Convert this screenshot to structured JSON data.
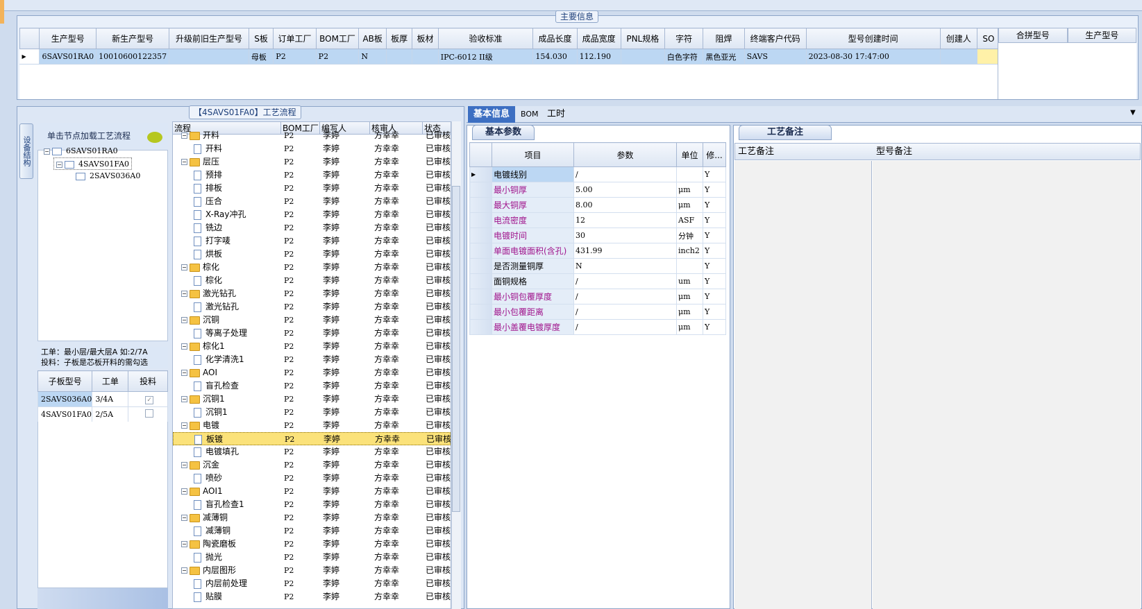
{
  "main_info": {
    "title": "主要信息",
    "columns": [
      "生产型号",
      "新生产型号",
      "升级前旧生产型号",
      "S板",
      "订单工厂",
      "BOM工厂",
      "AB板",
      "板厚",
      "板材",
      "验收标准",
      "成品长度",
      "成品宽度",
      "PNL规格",
      "字符",
      "阻焊",
      "终端客户代码",
      "型号创建时间",
      "创建人",
      "SO"
    ],
    "row": [
      "6SAVS01RA0",
      "10010600122357",
      "",
      "母板",
      "P2",
      "P2",
      "N",
      "",
      "",
      "IPC-6012 II级",
      "154.030",
      "112.190",
      "",
      "白色字符",
      "黑色亚光",
      "SAVS",
      "2023-08-30 17:47:00",
      "",
      ""
    ],
    "merge_columns": [
      "合拼型号",
      "生产型号"
    ]
  },
  "process": {
    "title": "【4SAVS01FA0】工艺流程",
    "side_tab": "设备结构",
    "hint": "单击节点加载工艺流程",
    "tree": [
      "6SAVS01RA0",
      "4SAVS01FA0",
      "2SAVS036A0"
    ],
    "note_line1": "工单：最小层/最大层A 如:2/7A",
    "note_line2": "投料：子板是芯板开料的需勾选",
    "sub_columns": [
      "子板型号",
      "工单",
      "投料"
    ],
    "sub_rows": [
      [
        "2SAVS036A0",
        "3/4A",
        "true"
      ],
      [
        "4SAVS01FA0",
        "2/5A",
        "false"
      ]
    ],
    "grid_columns": [
      "流程",
      "BOM工厂",
      "编写人",
      "核审人",
      "状态"
    ],
    "grid_rows": [
      {
        "name": "开料",
        "level": 0,
        "factory": "P2",
        "writer": "李婷",
        "reviewer": "方幸幸",
        "status": "已审核"
      },
      {
        "name": "开料",
        "level": 1,
        "factory": "P2",
        "writer": "李婷",
        "reviewer": "方幸幸",
        "status": "已审核"
      },
      {
        "name": "层压",
        "level": 0,
        "factory": "P2",
        "writer": "李婷",
        "reviewer": "方幸幸",
        "status": "已审核"
      },
      {
        "name": "预排",
        "level": 1,
        "factory": "P2",
        "writer": "李婷",
        "reviewer": "方幸幸",
        "status": "已审核"
      },
      {
        "name": "排板",
        "level": 1,
        "factory": "P2",
        "writer": "李婷",
        "reviewer": "方幸幸",
        "status": "已审核"
      },
      {
        "name": "压合",
        "level": 1,
        "factory": "P2",
        "writer": "李婷",
        "reviewer": "方幸幸",
        "status": "已审核"
      },
      {
        "name": "X-Ray冲孔",
        "level": 1,
        "factory": "P2",
        "writer": "李婷",
        "reviewer": "方幸幸",
        "status": "已审核"
      },
      {
        "name": "铣边",
        "level": 1,
        "factory": "P2",
        "writer": "李婷",
        "reviewer": "方幸幸",
        "status": "已审核"
      },
      {
        "name": "打字唛",
        "level": 1,
        "factory": "P2",
        "writer": "李婷",
        "reviewer": "方幸幸",
        "status": "已审核"
      },
      {
        "name": "烘板",
        "level": 1,
        "factory": "P2",
        "writer": "李婷",
        "reviewer": "方幸幸",
        "status": "已审核"
      },
      {
        "name": "棕化",
        "level": 0,
        "factory": "P2",
        "writer": "李婷",
        "reviewer": "方幸幸",
        "status": "已审核"
      },
      {
        "name": "棕化",
        "level": 1,
        "factory": "P2",
        "writer": "李婷",
        "reviewer": "方幸幸",
        "status": "已审核"
      },
      {
        "name": "激光钻孔",
        "level": 0,
        "factory": "P2",
        "writer": "李婷",
        "reviewer": "方幸幸",
        "status": "已审核"
      },
      {
        "name": "激光钻孔",
        "level": 1,
        "factory": "P2",
        "writer": "李婷",
        "reviewer": "方幸幸",
        "status": "已审核"
      },
      {
        "name": "沉铜",
        "level": 0,
        "factory": "P2",
        "writer": "李婷",
        "reviewer": "方幸幸",
        "status": "已审核"
      },
      {
        "name": "等离子处理",
        "level": 1,
        "factory": "P2",
        "writer": "李婷",
        "reviewer": "方幸幸",
        "status": "已审核"
      },
      {
        "name": "棕化1",
        "level": 0,
        "factory": "P2",
        "writer": "李婷",
        "reviewer": "方幸幸",
        "status": "已审核"
      },
      {
        "name": "化学清洗1",
        "level": 1,
        "factory": "P2",
        "writer": "李婷",
        "reviewer": "方幸幸",
        "status": "已审核"
      },
      {
        "name": "AOI",
        "level": 0,
        "factory": "P2",
        "writer": "李婷",
        "reviewer": "方幸幸",
        "status": "已审核"
      },
      {
        "name": "盲孔检查",
        "level": 1,
        "factory": "P2",
        "writer": "李婷",
        "reviewer": "方幸幸",
        "status": "已审核"
      },
      {
        "name": "沉铜1",
        "level": 0,
        "factory": "P2",
        "writer": "李婷",
        "reviewer": "方幸幸",
        "status": "已审核"
      },
      {
        "name": "沉铜1",
        "level": 1,
        "factory": "P2",
        "writer": "李婷",
        "reviewer": "方幸幸",
        "status": "已审核"
      },
      {
        "name": "电镀",
        "level": 0,
        "factory": "P2",
        "writer": "李婷",
        "reviewer": "方幸幸",
        "status": "已审核"
      },
      {
        "name": "板镀",
        "level": 1,
        "factory": "P2",
        "writer": "李婷",
        "reviewer": "方幸幸",
        "status": "已审核",
        "selected": true
      },
      {
        "name": "电镀填孔",
        "level": 1,
        "factory": "P2",
        "writer": "李婷",
        "reviewer": "方幸幸",
        "status": "已审核"
      },
      {
        "name": "沉金",
        "level": 0,
        "factory": "P2",
        "writer": "李婷",
        "reviewer": "方幸幸",
        "status": "已审核"
      },
      {
        "name": "喷砂",
        "level": 1,
        "factory": "P2",
        "writer": "李婷",
        "reviewer": "方幸幸",
        "status": "已审核"
      },
      {
        "name": "AOI1",
        "level": 0,
        "factory": "P2",
        "writer": "李婷",
        "reviewer": "方幸幸",
        "status": "已审核"
      },
      {
        "name": "盲孔检查1",
        "level": 1,
        "factory": "P2",
        "writer": "李婷",
        "reviewer": "方幸幸",
        "status": "已审核"
      },
      {
        "name": "减薄铜",
        "level": 0,
        "factory": "P2",
        "writer": "李婷",
        "reviewer": "方幸幸",
        "status": "已审核"
      },
      {
        "name": "减薄铜",
        "level": 1,
        "factory": "P2",
        "writer": "李婷",
        "reviewer": "方幸幸",
        "status": "已审核"
      },
      {
        "name": "陶瓷磨板",
        "level": 0,
        "factory": "P2",
        "writer": "李婷",
        "reviewer": "方幸幸",
        "status": "已审核"
      },
      {
        "name": "抛光",
        "level": 1,
        "factory": "P2",
        "writer": "李婷",
        "reviewer": "方幸幸",
        "status": "已审核"
      },
      {
        "name": "内层图形",
        "level": 0,
        "factory": "P2",
        "writer": "李婷",
        "reviewer": "方幸幸",
        "status": "已审核"
      },
      {
        "name": "内层前处理",
        "level": 1,
        "factory": "P2",
        "writer": "李婷",
        "reviewer": "方幸幸",
        "status": "已审核"
      },
      {
        "name": "贴膜",
        "level": 1,
        "factory": "P2",
        "writer": "李婷",
        "reviewer": "方幸幸",
        "status": "已审核"
      }
    ]
  },
  "detail": {
    "tabs": [
      "基本信息",
      "BOM",
      "工时"
    ],
    "basic_tab": "基本参数",
    "param_columns": [
      "项目",
      "参数",
      "单位",
      "修..."
    ],
    "params": [
      {
        "name": "电镀线别",
        "value": "/",
        "unit": "",
        "flag": "Y",
        "style": "cur"
      },
      {
        "name": "最小铜厚",
        "value": "5.00",
        "unit": "μm",
        "flag": "Y"
      },
      {
        "name": "最大铜厚",
        "value": "8.00",
        "unit": "μm",
        "flag": "Y"
      },
      {
        "name": "电流密度",
        "value": "12",
        "unit": "ASF",
        "flag": "Y"
      },
      {
        "name": "电镀时间",
        "value": "30",
        "unit": "分钟",
        "flag": "Y"
      },
      {
        "name": "单面电镀面积(含孔)",
        "value": "431.99",
        "unit": "inch2",
        "flag": "Y"
      },
      {
        "name": "是否测量铜厚",
        "value": "N",
        "unit": "",
        "flag": "Y",
        "style": "norm"
      },
      {
        "name": "面铜规格",
        "value": "/",
        "unit": "um",
        "flag": "Y",
        "style": "norm"
      },
      {
        "name": "最小铜包覆厚度",
        "value": "/",
        "unit": "μm",
        "flag": "Y"
      },
      {
        "name": "最小包覆距离",
        "value": "/",
        "unit": "μm",
        "flag": "Y"
      },
      {
        "name": "最小盖覆电镀厚度",
        "value": "/",
        "unit": "μm",
        "flag": "Y"
      }
    ],
    "remark_tab": "工艺备注",
    "remark_columns": [
      "工艺备注",
      "型号备注"
    ]
  }
}
